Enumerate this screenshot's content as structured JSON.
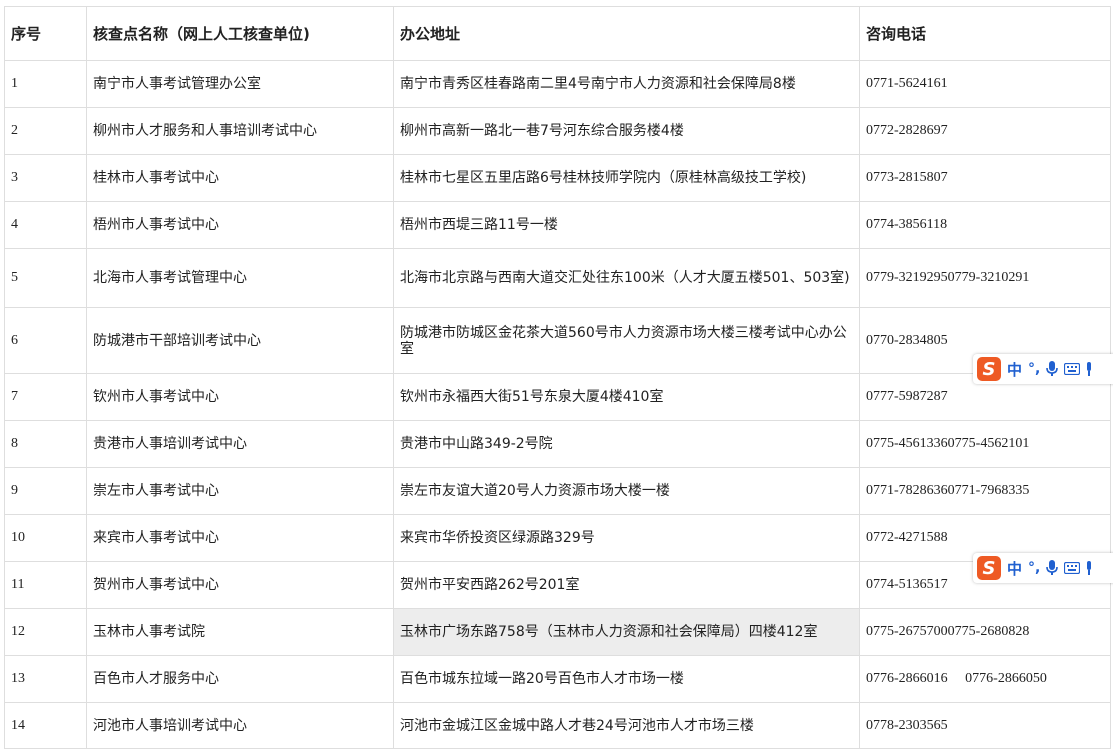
{
  "table": {
    "headers": [
      "序号",
      "核查点名称（网上人工核查单位)",
      "办公地址",
      "咨询电话"
    ],
    "rows": [
      {
        "no": "1",
        "name": "南宁市人事考试管理办公室",
        "addr": "南宁市青秀区桂春路南二里4号南宁市人力资源和社会保障局8楼",
        "phone": "0771-5624161"
      },
      {
        "no": "2",
        "name": "柳州市人才服务和人事培训考试中心",
        "addr": "柳州市高新一路北一巷7号河东综合服务楼4楼",
        "phone": "0772-2828697"
      },
      {
        "no": "3",
        "name": "桂林市人事考试中心",
        "addr": "桂林市七星区五里店路6号桂林技师学院内（原桂林高级技工学校)",
        "phone": "0773-2815807"
      },
      {
        "no": "4",
        "name": "梧州市人事考试中心",
        "addr": "梧州市西堤三路11号一楼",
        "phone": "0774-3856118"
      },
      {
        "no": "5",
        "name": "北海市人事考试管理中心",
        "addr": "北海市北京路与西南大道交汇处往东100米（人才大厦五楼501、503室)",
        "phone": "0779-32192950779-3210291"
      },
      {
        "no": "6",
        "name": "防城港市干部培训考试中心",
        "addr": "防城港市防城区金花茶大道560号市人力资源市场大楼三楼考试中心办公室",
        "phone": "0770-2834805"
      },
      {
        "no": "7",
        "name": "钦州市人事考试中心",
        "addr": "钦州市永福西大街51号东泉大厦4楼410室",
        "phone": "0777-5987287"
      },
      {
        "no": "8",
        "name": "贵港市人事培训考试中心",
        "addr": "贵港市中山路349-2号院",
        "phone": "0775-45613360775-4562101"
      },
      {
        "no": "9",
        "name": "崇左市人事考试中心",
        "addr": "崇左市友谊大道20号人力资源市场大楼一楼",
        "phone": "0771-78286360771-7968335"
      },
      {
        "no": "10",
        "name": "来宾市人事考试中心",
        "addr": "来宾市华侨投资区绿源路329号",
        "phone": "0772-4271588"
      },
      {
        "no": "11",
        "name": "贺州市人事考试中心",
        "addr": "贺州市平安西路262号201室",
        "phone": "0774-5136517"
      },
      {
        "no": "12",
        "name": "玉林市人事考试院",
        "addr": "玉林市广场东路758号（玉林市人力资源和社会保障局）四楼412室",
        "phone": "0775-26757000775-2680828"
      },
      {
        "no": "13",
        "name": "百色市人才服务中心",
        "addr": "百色市城东拉域一路20号百色市人才市场一楼",
        "phone": "0776-2866016　 0776-2866050"
      },
      {
        "no": "14",
        "name": "河池市人事培训考试中心",
        "addr": "河池市金城江区金城中路人才巷24号河池市人才市场三楼",
        "phone": "0778-2303565"
      }
    ]
  },
  "ime_toolbar": {
    "logo": "S",
    "mode": "中",
    "punct": "°,",
    "icons": [
      "sogou-logo-icon",
      "mic-icon",
      "keyboard-icon",
      "more-icon"
    ]
  }
}
